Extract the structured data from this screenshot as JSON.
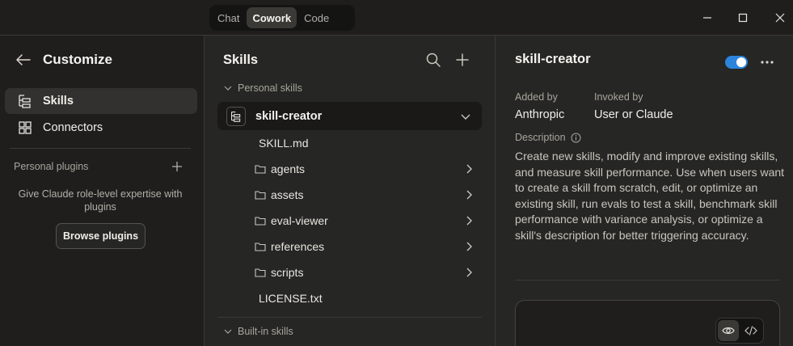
{
  "titlebar": {
    "modes": [
      {
        "label": "Chat",
        "active": false
      },
      {
        "label": "Cowork",
        "active": true
      },
      {
        "label": "Code",
        "active": false
      }
    ],
    "window_controls": [
      "minimize-icon",
      "maximize-icon",
      "close-icon"
    ]
  },
  "sidebar": {
    "title": "Customize",
    "back_icon": "arrow-left-icon",
    "nav": [
      {
        "label": "Skills",
        "icon": "skills-icon",
        "active": true
      },
      {
        "label": "Connectors",
        "icon": "connectors-icon",
        "active": false
      }
    ],
    "plugins_label": "Personal plugins",
    "plugins_desc": "Give Claude role-level expertise with plugins",
    "browse_button": "Browse plugins"
  },
  "skills_panel": {
    "title": "Skills",
    "personal_section": "Personal skills",
    "builtin_section": "Built-in skills",
    "selected_skill": "skill-creator",
    "files": [
      {
        "name": "SKILL.md",
        "type": "file"
      },
      {
        "name": "agents",
        "type": "folder"
      },
      {
        "name": "assets",
        "type": "folder"
      },
      {
        "name": "eval-viewer",
        "type": "folder"
      },
      {
        "name": "references",
        "type": "folder"
      },
      {
        "name": "scripts",
        "type": "folder"
      },
      {
        "name": "LICENSE.txt",
        "type": "file"
      }
    ]
  },
  "detail": {
    "title": "skill-creator",
    "enabled": true,
    "added_by_label": "Added by",
    "added_by": "Anthropic",
    "invoked_by_label": "Invoked by",
    "invoked_by": "User or Claude",
    "description_label": "Description",
    "description": "Create new skills, modify and improve existing skills, and measure skill performance. Use when users want to create a skill from scratch, edit, or optimize an existing skill, run evals to test a skill, benchmark skill performance with variance analysis, or optimize a skill's description for better triggering accuracy."
  },
  "colors": {
    "accent": "#2c84db",
    "background": "#262624",
    "sidebar": "#1f1e1d"
  }
}
